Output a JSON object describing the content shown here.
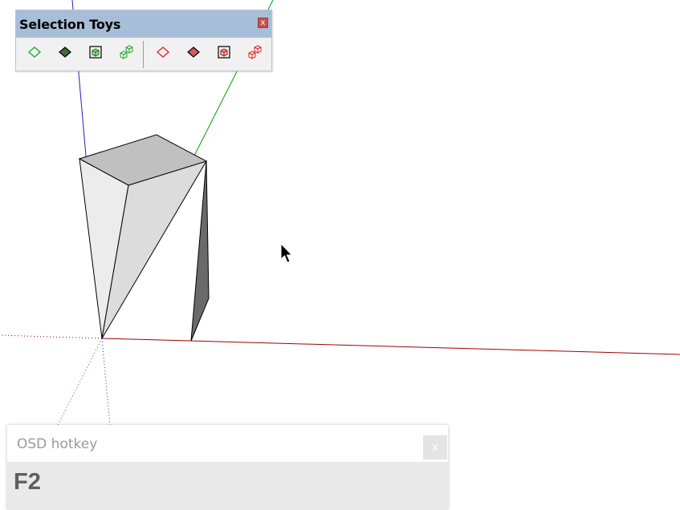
{
  "toolbar": {
    "title": "Selection Toys",
    "close_label": "x",
    "buttons": [
      {
        "name": "select-faces-button",
        "icon": "face-outline-icon",
        "color": "#1ea51e"
      },
      {
        "name": "select-faces-filled-button",
        "icon": "face-filled-icon",
        "color": "#1ea51e"
      },
      {
        "name": "select-groups-button",
        "icon": "group-cube-icon",
        "color": "#1ea51e"
      },
      {
        "name": "select-components-button",
        "icon": "component-cubes-icon",
        "color": "#1ea51e"
      },
      {
        "name": "deselect-faces-button",
        "icon": "face-outline-icon",
        "color": "#e02020"
      },
      {
        "name": "deselect-faces-filled-button",
        "icon": "face-filled-icon",
        "color": "#e02020"
      },
      {
        "name": "deselect-groups-button",
        "icon": "group-cube-icon",
        "color": "#e02020"
      },
      {
        "name": "deselect-components-button",
        "icon": "component-cubes-icon",
        "color": "#e02020"
      }
    ]
  },
  "osd": {
    "title": "OSD hotkey",
    "close_label": "x",
    "key": "F2"
  },
  "colors": {
    "axis_red": "#a00000",
    "axis_green": "#00a000",
    "axis_blue": "#0000c0",
    "toolbar_titlebar": "#a8bed8"
  }
}
